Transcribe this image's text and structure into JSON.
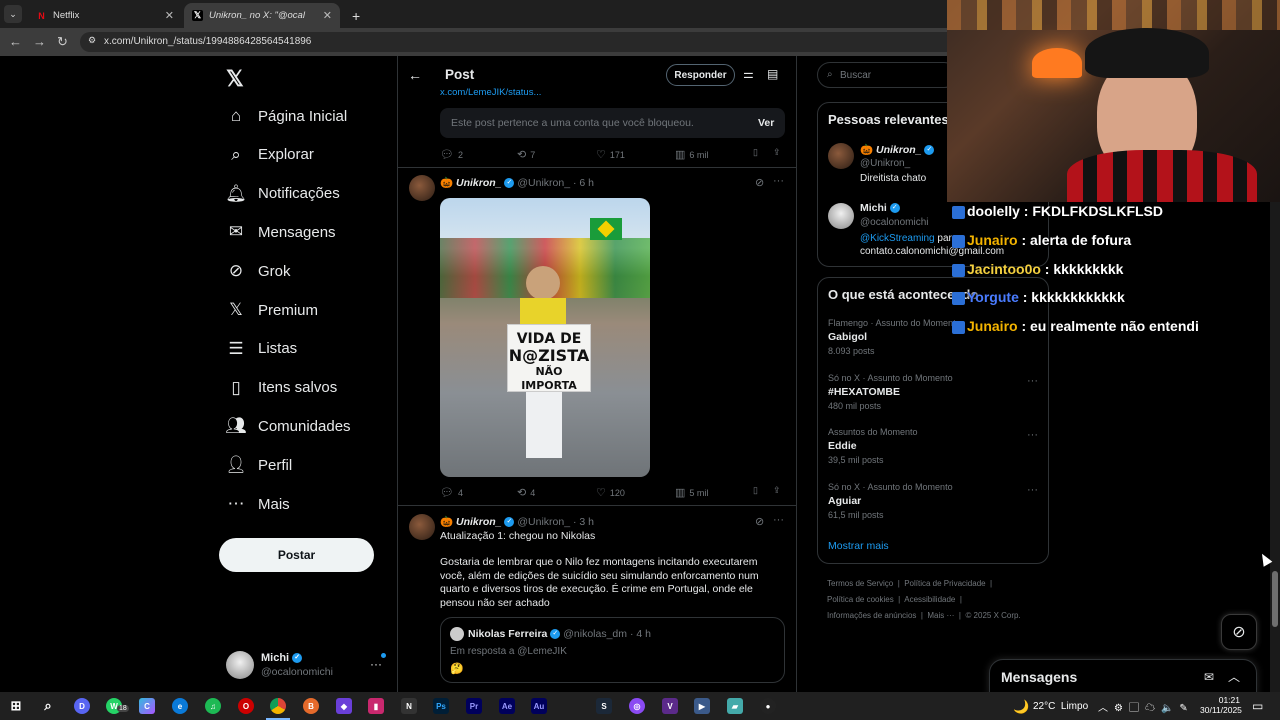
{
  "browser": {
    "tabs": [
      {
        "title": "Netflix",
        "icon": "netflix-icon"
      },
      {
        "title": "Unikron_ no X: \"@ocal",
        "icon": "x-icon"
      }
    ],
    "url": "x.com/Unikron_/status/1994886428564541896"
  },
  "sidebar": {
    "items": [
      {
        "label": "Página Inicial",
        "icon": "home-icon"
      },
      {
        "label": "Explorar",
        "icon": "search-icon"
      },
      {
        "label": "Notificações",
        "icon": "bell-icon"
      },
      {
        "label": "Mensagens",
        "icon": "mail-icon"
      },
      {
        "label": "Grok",
        "icon": "grok-icon"
      },
      {
        "label": "Premium",
        "icon": "x-logo-icon"
      },
      {
        "label": "Listas",
        "icon": "list-icon"
      },
      {
        "label": "Itens salvos",
        "icon": "bookmark-icon"
      },
      {
        "label": "Comunidades",
        "icon": "people-icon"
      },
      {
        "label": "Perfil",
        "icon": "user-icon"
      },
      {
        "label": "Mais",
        "icon": "more-icon"
      }
    ],
    "post_button": "Postar",
    "account": {
      "name": "Michi",
      "handle": "@ocalonomichi"
    }
  },
  "header": {
    "title": "Post",
    "reply_button": "Responder"
  },
  "blocked": {
    "link": "x.com/LemeJIK/status...",
    "text": "Este post pertence a uma conta que você bloqueou.",
    "view": "Ver"
  },
  "post1_actions": {
    "replies": "2",
    "reposts": "7",
    "likes": "171",
    "views": "6 mil"
  },
  "post2": {
    "name": "Unikron_",
    "handle": "@Unikron_",
    "time": "· 6 h",
    "sign_lines": [
      "VIDA DE",
      "N@ZISTA",
      "NÃO IMPORTA"
    ],
    "actions": {
      "replies": "4",
      "reposts": "4",
      "likes": "120",
      "views": "5 mil"
    }
  },
  "post3": {
    "name": "Unikron_",
    "handle": "@Unikron_",
    "time": "· 3 h",
    "line1": "Atualização 1: chegou no Nikolas",
    "body": "Gostaria de lembrar que o Nilo fez montagens incitando executarem você, além de edições de suicídio seu simulando enforcamento num quarto e diversos tiros de execução. É crime em Portugal, onde ele pensou não ser achado",
    "quote": {
      "name": "Nikolas Ferreira",
      "handle": "@nikolas_dm",
      "time": "· 4 h",
      "reply_to": "Em resposta a @LemeJIK",
      "emoji": "🤔"
    }
  },
  "search": {
    "placeholder": "Buscar"
  },
  "relevant": {
    "title": "Pessoas relevantes",
    "people": [
      {
        "name": "Unikron_",
        "handle": "@Unikron_",
        "bio": "Direitista chato"
      },
      {
        "name": "Michi",
        "handle": "@ocalonomichi",
        "bio_link": "@KickStreaming",
        "bio_rest": " par",
        "bio2": "contato.calonomichi@gmail.com"
      }
    ]
  },
  "trends": {
    "title": "O que está acontecendo",
    "items": [
      {
        "category": "Flamengo · Assunto do Momento",
        "name": "Gabigol",
        "count": "8.093 posts"
      },
      {
        "category": "Só no X · Assunto do Momento",
        "name": "#HEXATOMBE",
        "count": "480 mil posts"
      },
      {
        "category": "Assuntos do Momento",
        "name": "Eddie",
        "count": "39,5 mil posts"
      },
      {
        "category": "Só no X · Assunto do Momento",
        "name": "Aguiar",
        "count": "61,5 mil posts"
      }
    ],
    "show_more": "Mostrar mais"
  },
  "footer": {
    "links": [
      "Termos de Serviço",
      "Política de Privacidade",
      "Política de cookies",
      "Acessibilidade",
      "Informações de anúncios",
      "Mais ···",
      "© 2025 X Corp."
    ]
  },
  "messages": {
    "title": "Mensagens"
  },
  "chat": [
    {
      "user": "doolelly",
      "msg": " : FKDLFKDSLKFLSD",
      "color": "#ffffff"
    },
    {
      "user": "Junairo",
      "msg": " : alerta de fofura",
      "color": "#f4b400"
    },
    {
      "user": "Jacintoo0o",
      "msg": " : kkkkkkkkk",
      "color": "#f4d03f"
    },
    {
      "user": "Yorgute",
      "msg": " : kkkkkkkkkkkk",
      "color": "#4a7cff"
    },
    {
      "user": "Junairo",
      "msg": " : eu realmente não entendi",
      "color": "#f4b400"
    }
  ],
  "taskbar": {
    "weather": "22°C  Limpo",
    "time": "01:21",
    "date": "30/11/2025",
    "badge": "18"
  }
}
